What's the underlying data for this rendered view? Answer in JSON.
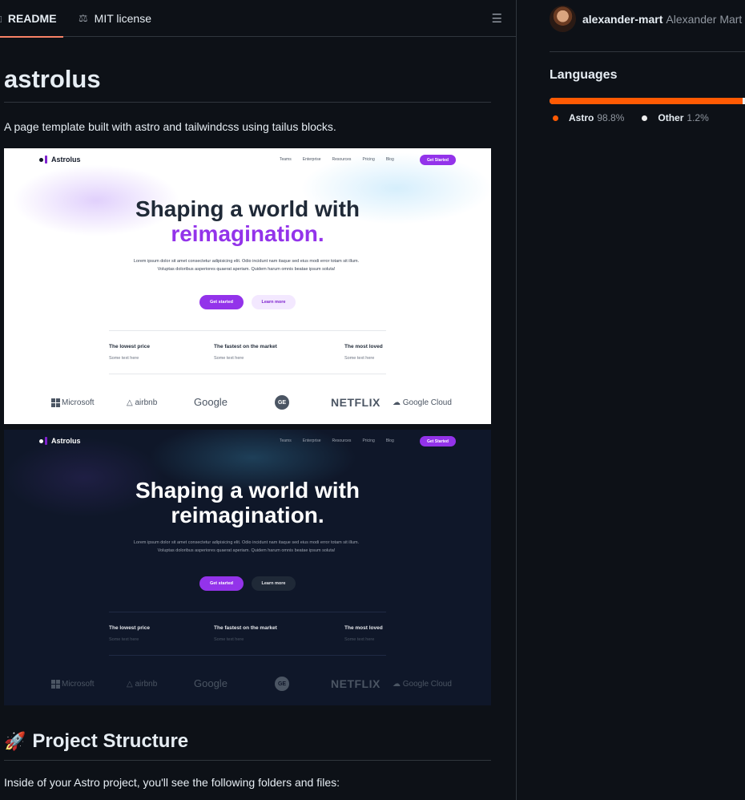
{
  "tabs": {
    "readme_label": "README",
    "license_label": "MIT license",
    "readme_icon": "book-icon",
    "license_icon": "scale-icon",
    "toc_icon": "list-icon"
  },
  "readme": {
    "title": "astrolus",
    "description": "A page template built with astro and tailwindcss using tailus blocks.",
    "section_heading": "Project Structure",
    "section_emoji": "🚀",
    "section_text": "Inside of your Astro project, you'll see the following folders and files:"
  },
  "preview": {
    "logo": "Astrolus",
    "nav": [
      "Teams",
      "Enterprise",
      "Resources",
      "Pricing",
      "Blog"
    ],
    "cta": "Get Started",
    "headline_line1": "Shaping a world with",
    "headline_line2": "reimagination.",
    "lorem_line1": "Lorem ipsum dolor sit amet consectetur adipisicing elit. Odio incidunt nam itaque sed eius modi error totam sit illum.",
    "lorem_line2": "Voluptas doloribus asperiores quaerat aperiam. Quidem harum omnis beatae ipsum soluta!",
    "primary_button": "Get started",
    "secondary_button": "Learn more",
    "features": [
      {
        "title": "The lowest price",
        "sub": "Some text here"
      },
      {
        "title": "The fastest on the market",
        "sub": "Some text here"
      },
      {
        "title": "The most loved",
        "sub": "Some text here"
      }
    ],
    "brands": [
      "Microsoft",
      "airbnb",
      "Google",
      "GE",
      "NETFLIX",
      "Google Cloud"
    ]
  },
  "sidebar": {
    "contributor_username": "alexander-mart",
    "contributor_name": "Alexander Mart",
    "languages_title": "Languages",
    "languages": [
      {
        "name": "Astro",
        "percent": "98.8%",
        "color": "#ff5a03",
        "share": 0.988
      },
      {
        "name": "Other",
        "percent": "1.2%",
        "color": "#ededed",
        "share": 0.012
      }
    ]
  },
  "colors": {
    "accent_underline": "#f78166",
    "purple": "#9333ea",
    "astro_orange": "#ff5a03"
  }
}
